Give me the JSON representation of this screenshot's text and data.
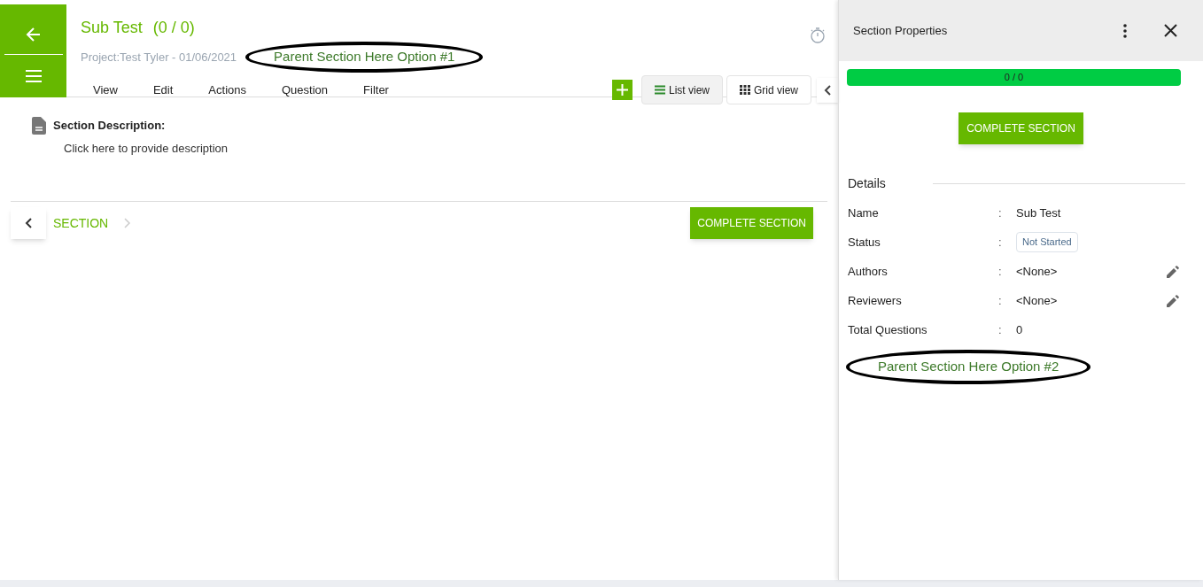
{
  "header": {
    "title": "Sub Test",
    "count": "(0 / 0)",
    "project": "Project:Test Tyler - 01/06/2021",
    "callout": "Parent Section Here Option #1"
  },
  "menu": [
    "View",
    "Edit",
    "Actions",
    "Question",
    "Filter"
  ],
  "views": [
    {
      "label": "List view",
      "kind": "list",
      "selected": true
    },
    {
      "label": "Grid view",
      "kind": "grid",
      "selected": false
    }
  ],
  "description": {
    "label": "Section Description:",
    "placeholder": "Click here to provide description"
  },
  "pager": {
    "label": "SECTION",
    "prev_disabled": false,
    "next_disabled": true,
    "button": "COMPLETE SECTION"
  },
  "panel": {
    "title": "Section Properties",
    "progress": {
      "reading": "0 / 0",
      "level": 1
    },
    "button": "COMPLETE SECTION",
    "details_title": "Details",
    "rows": [
      {
        "label": "Name",
        "separator": ":",
        "value": "Sub Test",
        "kind": "text"
      },
      {
        "label": "Status",
        "separator": ":",
        "value": "Not Started",
        "kind": "status"
      },
      {
        "label": "Authors",
        "separator": ":",
        "value": "<None>",
        "kind": "editable"
      },
      {
        "label": "Reviewers",
        "separator": ":",
        "value": "<None>",
        "kind": "editable"
      },
      {
        "label": "Total Questions",
        "separator": ":",
        "value": "0",
        "kind": "text"
      }
    ],
    "callout": "Parent Section Here Option #2"
  }
}
